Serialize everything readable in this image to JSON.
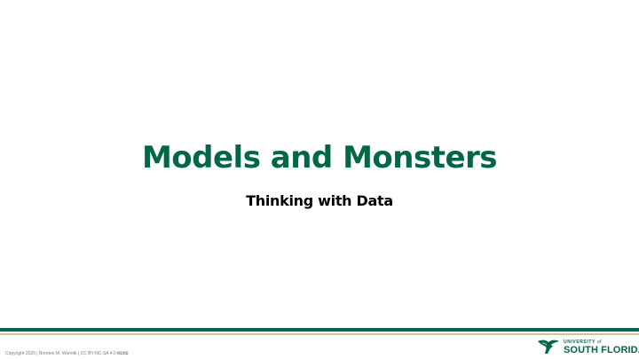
{
  "slide": {
    "title": "Models and Monsters",
    "subtitle": "Thinking with Data"
  },
  "footer": {
    "copyright": "Copyright 2020 | Brenton M. Wiernik | CC BY-NC-SA 4.0 🅭🅯🄏🄎",
    "logo": {
      "line1": "UNIVERSITY",
      "of": "of",
      "line2": "SOUTH FLORIDA",
      "icon": "usf-bull-icon"
    }
  },
  "colors": {
    "green": "#006747",
    "gold": "#CFC493",
    "background": "#FFFFFF"
  }
}
